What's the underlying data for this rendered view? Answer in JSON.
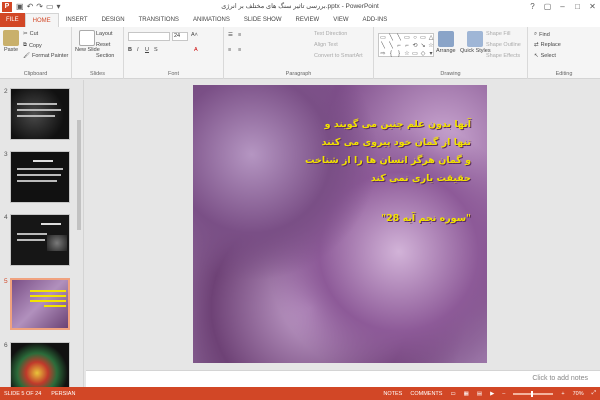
{
  "window": {
    "title": "بررسی تاثیر سنگ های مختلف بر انرژی.pptx - PowerPoint",
    "app_icon": "P"
  },
  "tabs": [
    "FILE",
    "HOME",
    "INSERT",
    "DESIGN",
    "TRANSITIONS",
    "ANIMATIONS",
    "SLIDE SHOW",
    "REVIEW",
    "VIEW",
    "ADD-INS"
  ],
  "active_tab": "HOME",
  "ribbon": {
    "clipboard": {
      "label": "Clipboard",
      "paste": "Paste",
      "cut": "Cut",
      "copy": "Copy",
      "format_painter": "Format Painter"
    },
    "slides": {
      "label": "Slides",
      "new_slide": "New Slide",
      "layout": "Layout",
      "reset": "Reset",
      "section": "Section"
    },
    "font": {
      "label": "Font",
      "size": "24"
    },
    "paragraph": {
      "label": "Paragraph",
      "text_direction": "Text Direction",
      "align_text": "Align Text",
      "convert": "Convert to SmartArt"
    },
    "drawing": {
      "label": "Drawing",
      "arrange": "Arrange",
      "quick_styles": "Quick Styles",
      "shape_fill": "Shape Fill",
      "shape_outline": "Shape Outline",
      "shape_effects": "Shape Effects"
    },
    "editing": {
      "label": "Editing",
      "find": "Find",
      "replace": "Replace",
      "select": "Select"
    }
  },
  "thumbnails": [
    {
      "num": "2"
    },
    {
      "num": "3"
    },
    {
      "num": "4"
    },
    {
      "num": "5"
    },
    {
      "num": "6"
    }
  ],
  "slide": {
    "lines": [
      "آنها بدون علم چنین می گویند و",
      "تنها از گمان خود پیروی می کنند",
      "و گمان هرگز انسان ها را از شناخت",
      "حقیقت یاری نمی کند",
      "\"سوره نجم آیه 28\""
    ]
  },
  "notes_placeholder": "Click to add notes",
  "status": {
    "slide": "SLIDE 5 OF 24",
    "language": "PERSIAN",
    "notes": "NOTES",
    "comments": "COMMENTS",
    "zoom": "70%"
  }
}
